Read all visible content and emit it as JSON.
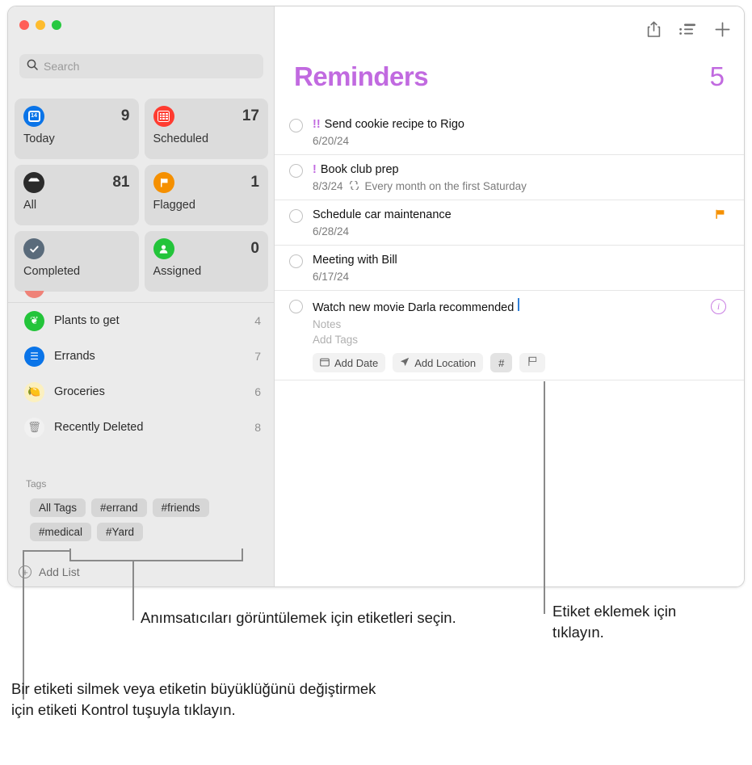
{
  "window": {
    "traffic_lights": [
      "close",
      "minimize",
      "zoom"
    ]
  },
  "sidebar": {
    "search": {
      "placeholder": "Search",
      "value": "",
      "icon": "search-icon"
    },
    "smart_lists": [
      {
        "label": "Today",
        "count": "9",
        "icon": "calendar-icon",
        "icon_text": "14",
        "color": "#0a74e8"
      },
      {
        "label": "Scheduled",
        "count": "17",
        "icon": "calendar-grid-icon",
        "color": "#ff3b30"
      },
      {
        "label": "All",
        "count": "81",
        "icon": "inbox-tray-icon",
        "color": "#2b2b2b"
      },
      {
        "label": "Flagged",
        "count": "1",
        "icon": "flag-icon",
        "color": "#f59000"
      },
      {
        "label": "Completed",
        "count": "",
        "icon": "checkmark-circle-icon",
        "color": "#5a6b7b"
      },
      {
        "label": "Assigned",
        "count": "0",
        "icon": "person-icon",
        "color": "#23c43a"
      }
    ],
    "lists": [
      {
        "name": "Plants to get",
        "count": "4",
        "icon": "leaf-icon",
        "glyph": "❦",
        "color": "#23c43a"
      },
      {
        "name": "Errands",
        "count": "7",
        "icon": "list-bullet-icon",
        "glyph": "☰",
        "color": "#0a74e8"
      },
      {
        "name": "Groceries",
        "count": "6",
        "icon": "lemon-icon",
        "glyph": "🍋",
        "color": "#fbf0c0"
      },
      {
        "name": "Recently Deleted",
        "count": "8",
        "icon": "trash-icon",
        "glyph": "🗑",
        "color": "#f1f1f1"
      }
    ],
    "tags_header": "Tags",
    "tags": [
      "All Tags",
      "#errand",
      "#friends",
      "#medical",
      "#Yard"
    ],
    "add_list_label": "Add List",
    "add_list_icon": "plus-circle-icon"
  },
  "main": {
    "toolbar": [
      {
        "name": "share-icon",
        "label": "Share"
      },
      {
        "name": "sort-list-icon",
        "label": "View Options"
      },
      {
        "name": "plus-icon",
        "label": "New Reminder"
      }
    ],
    "title": "Reminders",
    "count": "5",
    "title_color": "#c16ae0",
    "reminders": [
      {
        "priority": "!!",
        "title": "Send cookie recipe to Rigo",
        "date": "6/20/24",
        "repeat": "",
        "flagged": false,
        "editing": false
      },
      {
        "priority": "!",
        "title": "Book club prep",
        "date": "8/3/24",
        "repeat": "Every month on the first Saturday",
        "repeat_icon": "repeat-icon",
        "flagged": false,
        "editing": false
      },
      {
        "priority": "",
        "title": "Schedule car maintenance",
        "date": "6/28/24",
        "repeat": "",
        "flagged": true,
        "flag_icon": "flag-icon",
        "editing": false
      },
      {
        "priority": "",
        "title": "Meeting with Bill",
        "date": "6/17/24",
        "repeat": "",
        "flagged": false,
        "editing": false
      },
      {
        "priority": "",
        "title": "Watch new movie Darla recommended",
        "notes_placeholder": "Notes",
        "tags_placeholder": "Add Tags",
        "editing": true,
        "info_icon": "info-circle-icon",
        "chips": [
          {
            "label": "Add Date",
            "icon": "calendar-small-icon",
            "active": false
          },
          {
            "label": "Add Location",
            "icon": "location-arrow-icon",
            "active": false
          },
          {
            "label": "#",
            "icon": "hashtag-icon",
            "active": true
          },
          {
            "label": "",
            "icon": "flag-outline-icon",
            "active": false
          }
        ]
      }
    ]
  },
  "annotations": [
    {
      "name": "tags-select-callout",
      "text": "Anımsatıcıları görüntülemek için etiketleri seçin."
    },
    {
      "name": "tag-delete-callout",
      "text": "Bir etiketi silmek veya etiketin büyüklüğünü değiştirmek için etiketi Kontrol tuşuyla tıklayın."
    },
    {
      "name": "add-tag-callout",
      "text": "Etiket eklemek için tıklayın."
    }
  ]
}
